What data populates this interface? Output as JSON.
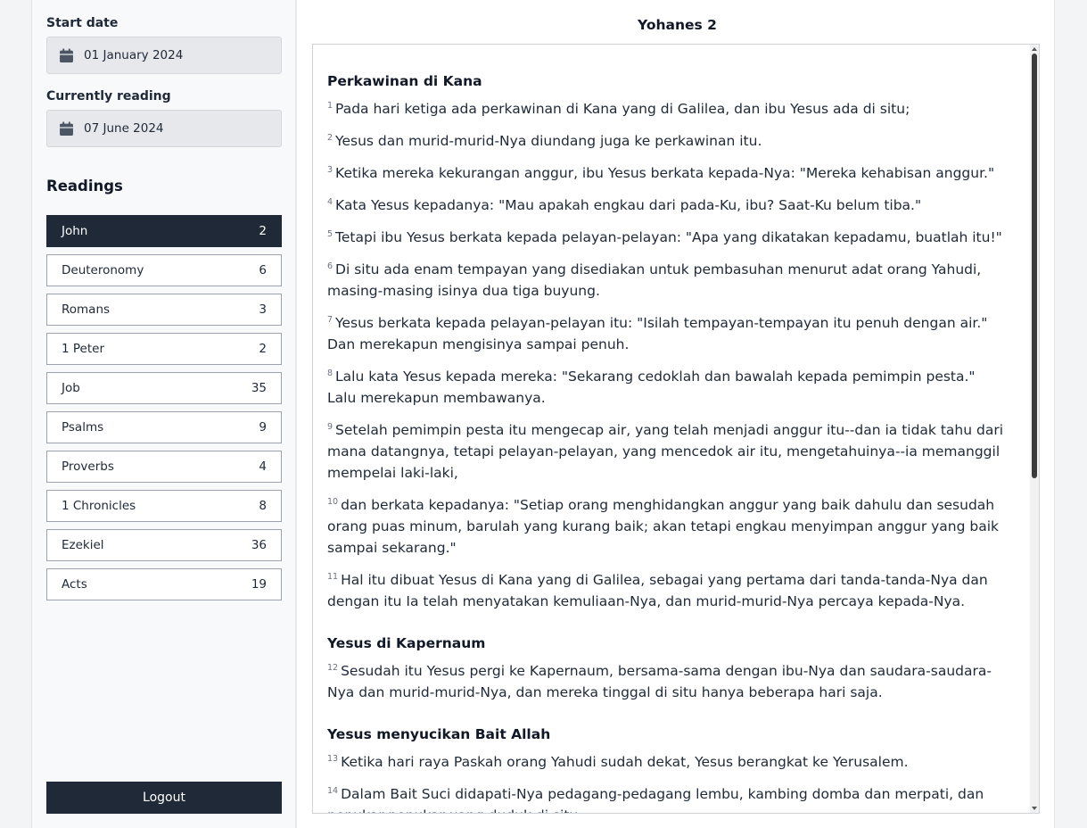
{
  "sidebar": {
    "start_date": {
      "label": "Start date",
      "value": "01 January 2024",
      "icon": "calendar-icon"
    },
    "current": {
      "label": "Currently reading",
      "value": "07 June 2024",
      "icon": "calendar-icon"
    },
    "readings_title": "Readings",
    "readings": [
      {
        "book": "John",
        "chapter": "2",
        "active": true
      },
      {
        "book": "Deuteronomy",
        "chapter": "6"
      },
      {
        "book": "Romans",
        "chapter": "3"
      },
      {
        "book": "1 Peter",
        "chapter": "2"
      },
      {
        "book": "Job",
        "chapter": "35"
      },
      {
        "book": "Psalms",
        "chapter": "9"
      },
      {
        "book": "Proverbs",
        "chapter": "4"
      },
      {
        "book": "1 Chronicles",
        "chapter": "8"
      },
      {
        "book": "Ezekiel",
        "chapter": "36"
      },
      {
        "book": "Acts",
        "chapter": "19"
      }
    ],
    "logout_label": "Logout"
  },
  "main": {
    "chapter_title": "Yohanes 2",
    "sections": [
      {
        "heading": "Perkawinan di Kana",
        "verses": [
          {
            "num": "1",
            "text": "Pada hari ketiga ada perkawinan di Kana yang di Galilea, dan ibu Yesus ada di situ;"
          },
          {
            "num": "2",
            "text": "Yesus dan murid-murid-Nya diundang juga ke perkawinan itu."
          },
          {
            "num": "3",
            "text": "Ketika mereka kekurangan anggur, ibu Yesus berkata kepada-Nya: \"Mereka kehabisan anggur.\""
          },
          {
            "num": "4",
            "text": "Kata Yesus kepadanya: \"Mau apakah engkau dari pada-Ku, ibu? Saat-Ku belum tiba.\""
          },
          {
            "num": "5",
            "text": "Tetapi ibu Yesus berkata kepada pelayan-pelayan: \"Apa yang dikatakan kepadamu, buatlah itu!\""
          },
          {
            "num": "6",
            "text": "Di situ ada enam tempayan yang disediakan untuk pembasuhan menurut adat orang Yahudi, masing-masing isinya dua tiga buyung."
          },
          {
            "num": "7",
            "text": "Yesus berkata kepada pelayan-pelayan itu: \"Isilah tempayan-tempayan itu penuh dengan air.\" Dan merekapun mengisinya sampai penuh."
          },
          {
            "num": "8",
            "text": "Lalu kata Yesus kepada mereka: \"Sekarang cedoklah dan bawalah kepada pemimpin pesta.\" Lalu merekapun membawanya."
          },
          {
            "num": "9",
            "text": "Setelah pemimpin pesta itu mengecap air, yang telah menjadi anggur itu--dan ia tidak tahu dari mana datangnya, tetapi pelayan-pelayan, yang mencedok air itu, mengetahuinya--ia memanggil mempelai laki-laki,"
          },
          {
            "num": "10",
            "text": "dan berkata kepadanya: \"Setiap orang menghidangkan anggur yang baik dahulu dan sesudah orang puas minum, barulah yang kurang baik; akan tetapi engkau menyimpan anggur yang baik sampai sekarang.\""
          },
          {
            "num": "11",
            "text": "Hal itu dibuat Yesus di Kana yang di Galilea, sebagai yang pertama dari tanda-tanda-Nya dan dengan itu Ia telah menyatakan kemuliaan-Nya, dan murid-murid-Nya percaya kepada-Nya."
          }
        ]
      },
      {
        "heading": "Yesus di Kapernaum",
        "verses": [
          {
            "num": "12",
            "text": "Sesudah itu Yesus pergi ke Kapernaum, bersama-sama dengan ibu-Nya dan saudara-saudara-Nya dan murid-murid-Nya, dan mereka tinggal di situ hanya beberapa hari saja."
          }
        ]
      },
      {
        "heading": "Yesus menyucikan Bait Allah",
        "verses": [
          {
            "num": "13",
            "text": "Ketika hari raya Paskah orang Yahudi sudah dekat, Yesus berangkat ke Yerusalem."
          },
          {
            "num": "14",
            "text": "Dalam Bait Suci didapati-Nya pedagang-pedagang lembu, kambing domba dan merpati, dan penukar-penukar uang duduk di situ."
          }
        ]
      }
    ]
  }
}
